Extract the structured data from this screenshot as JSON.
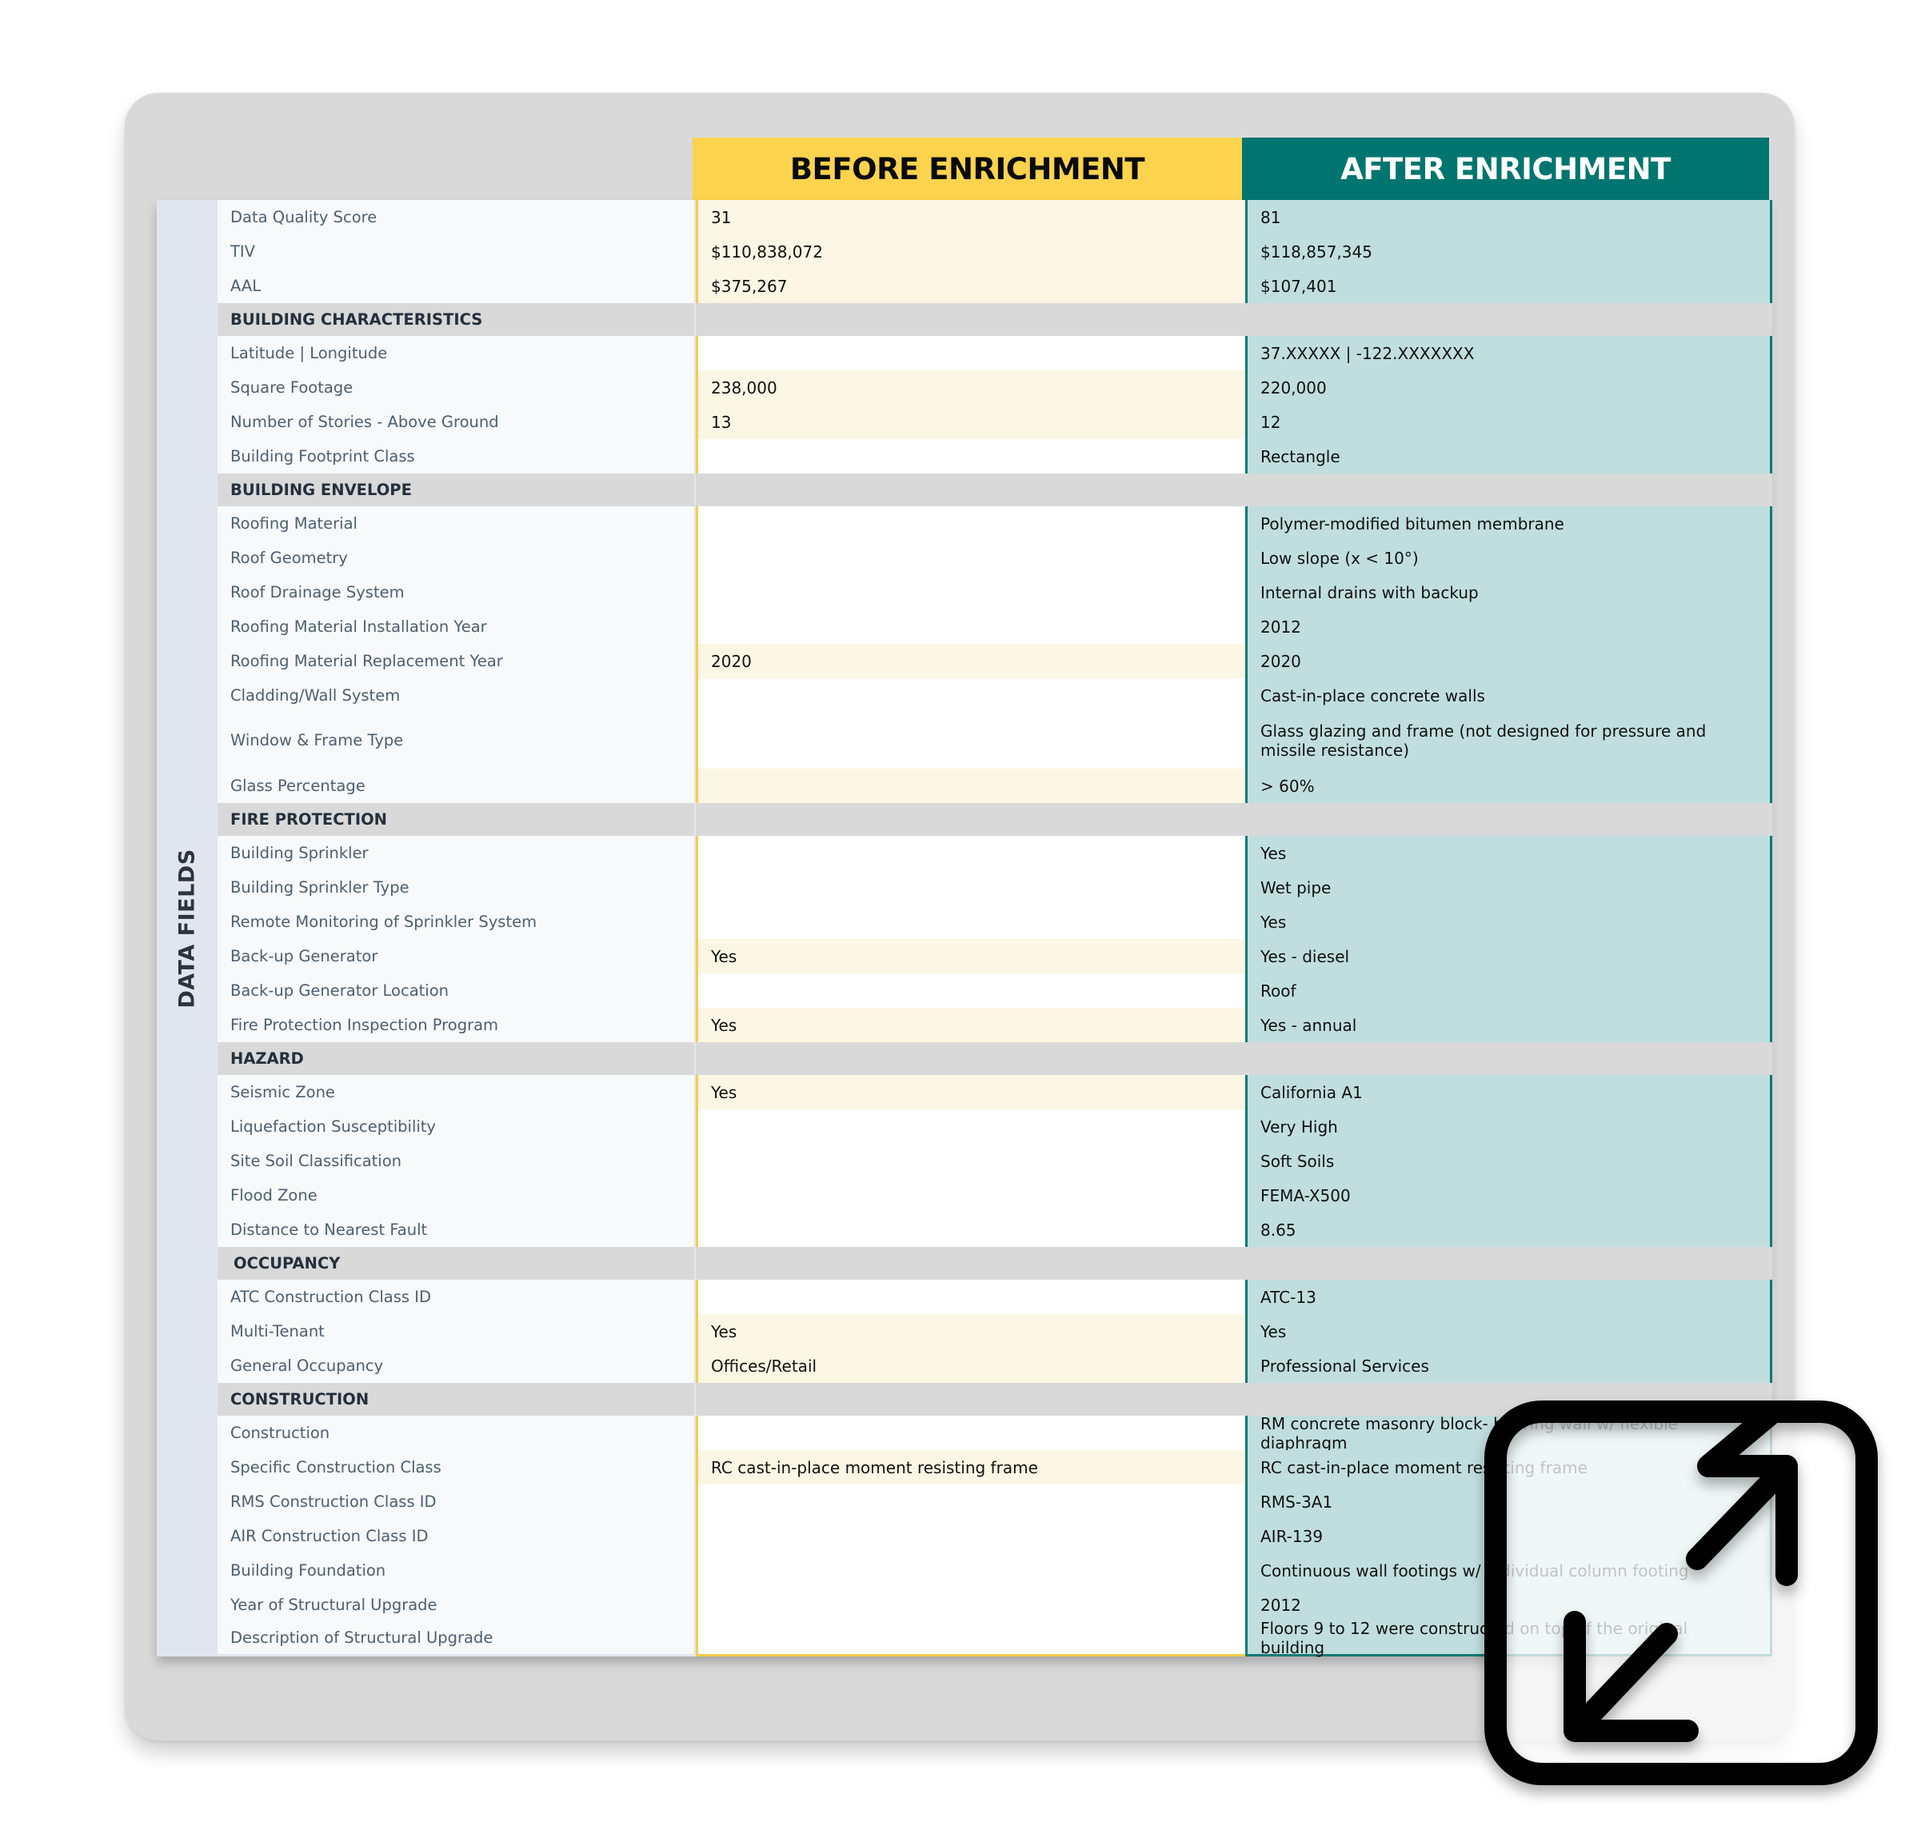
{
  "headers": {
    "before": "BEFORE ENRICHMENT",
    "after": "AFTER ENRICHMENT"
  },
  "side_label": "DATA FIELDS",
  "colors": {
    "before_header": "#fcd34d",
    "after_header": "#00756f",
    "before_cell_tint": "#fcf6e4",
    "after_cell": "#c0dedd",
    "section_bg": "#d9d9d9"
  },
  "rows": [
    {
      "type": "field",
      "label": "Data Quality Score",
      "before": "31",
      "after": "81",
      "before_tinted": true
    },
    {
      "type": "field",
      "label": "TIV",
      "before": "$110,838,072",
      "after": "$118,857,345",
      "before_tinted": true
    },
    {
      "type": "field",
      "label": "AAL",
      "before": "$375,267",
      "after": "$107,401",
      "before_tinted": true
    },
    {
      "type": "section",
      "label": "BUILDING CHARACTERISTICS"
    },
    {
      "type": "field",
      "label": "Latitude | Longitude",
      "before": "",
      "after": "37.XXXXX | -122.XXXXXXX"
    },
    {
      "type": "field",
      "label": "Square Footage",
      "before": "238,000",
      "after": "220,000",
      "before_tinted": true
    },
    {
      "type": "field",
      "label": "Number of Stories - Above Ground",
      "before": "13",
      "after": "12",
      "before_tinted": true
    },
    {
      "type": "field",
      "label": "Building Footprint Class",
      "before": "",
      "after": "Rectangle"
    },
    {
      "type": "section",
      "label": "BUILDING ENVELOPE"
    },
    {
      "type": "field",
      "label": "Roofing Material",
      "before": "",
      "after": "Polymer-modified bitumen membrane"
    },
    {
      "type": "field",
      "label": "Roof Geometry",
      "before": "",
      "after": "Low slope (x < 10°)"
    },
    {
      "type": "field",
      "label": "Roof Drainage System",
      "before": "",
      "after": "Internal drains with backup"
    },
    {
      "type": "field",
      "label": "Roofing Material Installation Year",
      "before": "",
      "after": "2012"
    },
    {
      "type": "field",
      "label": "Roofing Material Replacement Year",
      "before": "2020",
      "after": "2020",
      "before_tinted": true
    },
    {
      "type": "field",
      "label": "Cladding/Wall System",
      "before": "",
      "after": "Cast-in-place concrete walls"
    },
    {
      "type": "field",
      "label": "Window & Frame Type",
      "before": "",
      "after": "Glass glazing and frame (not designed for pressure and missile resistance)",
      "tall": true
    },
    {
      "type": "field",
      "label": "Glass Percentage",
      "before": "",
      "after": "> 60%",
      "before_tinted": true
    },
    {
      "type": "section",
      "label": "FIRE PROTECTION"
    },
    {
      "type": "field",
      "label": "Building Sprinkler",
      "before": "",
      "after": "Yes"
    },
    {
      "type": "field",
      "label": "Building Sprinkler Type",
      "before": "",
      "after": "Wet pipe"
    },
    {
      "type": "field",
      "label": "Remote Monitoring of Sprinkler System",
      "before": "",
      "after": "Yes"
    },
    {
      "type": "field",
      "label": "Back-up Generator",
      "before": "Yes",
      "after": "Yes - diesel",
      "before_tinted": true
    },
    {
      "type": "field",
      "label": "Back-up Generator Location",
      "before": "",
      "after": "Roof"
    },
    {
      "type": "field",
      "label": "Fire Protection Inspection Program",
      "before": "Yes",
      "after": "Yes - annual",
      "before_tinted": true
    },
    {
      "type": "section",
      "label": "HAZARD"
    },
    {
      "type": "field",
      "label": "Seismic Zone",
      "before": "Yes",
      "after": "California A1",
      "before_tinted": true
    },
    {
      "type": "field",
      "label": "Liquefaction Susceptibility",
      "before": "",
      "after": "Very High"
    },
    {
      "type": "field",
      "label": "Site Soil Classification",
      "before": "",
      "after": "Soft Soils"
    },
    {
      "type": "field",
      "label": "Flood Zone",
      "before": "",
      "after": "FEMA-X500"
    },
    {
      "type": "field",
      "label": "Distance to Nearest Fault",
      "before": "",
      "after": "8.65"
    },
    {
      "type": "section",
      "label": "OCCUPANCY",
      "indent": true
    },
    {
      "type": "field",
      "label": "ATC Construction Class ID",
      "before": "",
      "after": "ATC-13"
    },
    {
      "type": "field",
      "label": "Multi-Tenant",
      "before": "Yes",
      "after": "Yes",
      "before_tinted": true
    },
    {
      "type": "field",
      "label": "General Occupancy",
      "before": "Offices/Retail",
      "after": "Professional Services",
      "before_tinted": true
    },
    {
      "type": "section",
      "label": "CONSTRUCTION"
    },
    {
      "type": "field",
      "label": "Construction",
      "before": "",
      "after": "RM concrete masonry block- bearing wall w/ flexible diaphragm"
    },
    {
      "type": "field",
      "label": "Specific Construction Class",
      "before": "RC cast-in-place moment resisting frame",
      "after": "RC cast-in-place moment resisting frame",
      "before_tinted": true
    },
    {
      "type": "field",
      "label": "RMS Construction Class ID",
      "before": "",
      "after": "RMS-3A1"
    },
    {
      "type": "field",
      "label": "AIR Construction Class ID",
      "before": "",
      "after": "AIR-139"
    },
    {
      "type": "field",
      "label": "Building Foundation",
      "before": "",
      "after": "Continuous wall footings w/ individual column footing"
    },
    {
      "type": "field",
      "label": "Year of Structural Upgrade",
      "before": "",
      "after": "2012"
    },
    {
      "type": "field",
      "label": "Description of Structural Upgrade",
      "before": "",
      "after": "Floors 9 to 12 were constructed on top of the original building"
    }
  ],
  "overlay": {
    "icon": "expand-arrows-icon"
  }
}
